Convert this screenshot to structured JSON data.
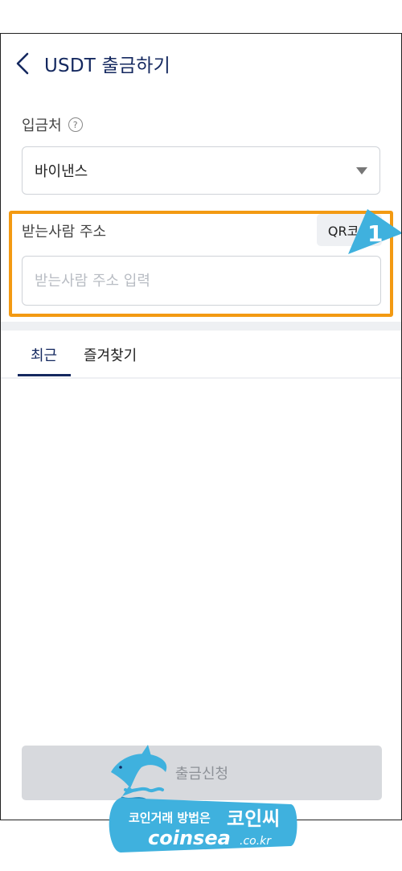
{
  "header": {
    "title": "USDT 출금하기"
  },
  "destination": {
    "label": "입금처",
    "help_glyph": "?",
    "selected": "바이낸스"
  },
  "recipient": {
    "label": "받는사람 주소",
    "qr_button": "QR코드",
    "placeholder": "받는사람 주소 입력"
  },
  "tabs": [
    {
      "label": "최근",
      "active": true
    },
    {
      "label": "즐겨찾기",
      "active": false
    }
  ],
  "submit": {
    "label": "출금신청"
  },
  "annotation": {
    "number": "1"
  },
  "watermark": {
    "line1": "코인거래 방법은",
    "brand": "코인씨",
    "domain": "coinsea",
    "tld": ".co.kr"
  },
  "colors": {
    "accent": "#14285f",
    "highlight": "#f39a12",
    "marker": "#3fb1de"
  }
}
